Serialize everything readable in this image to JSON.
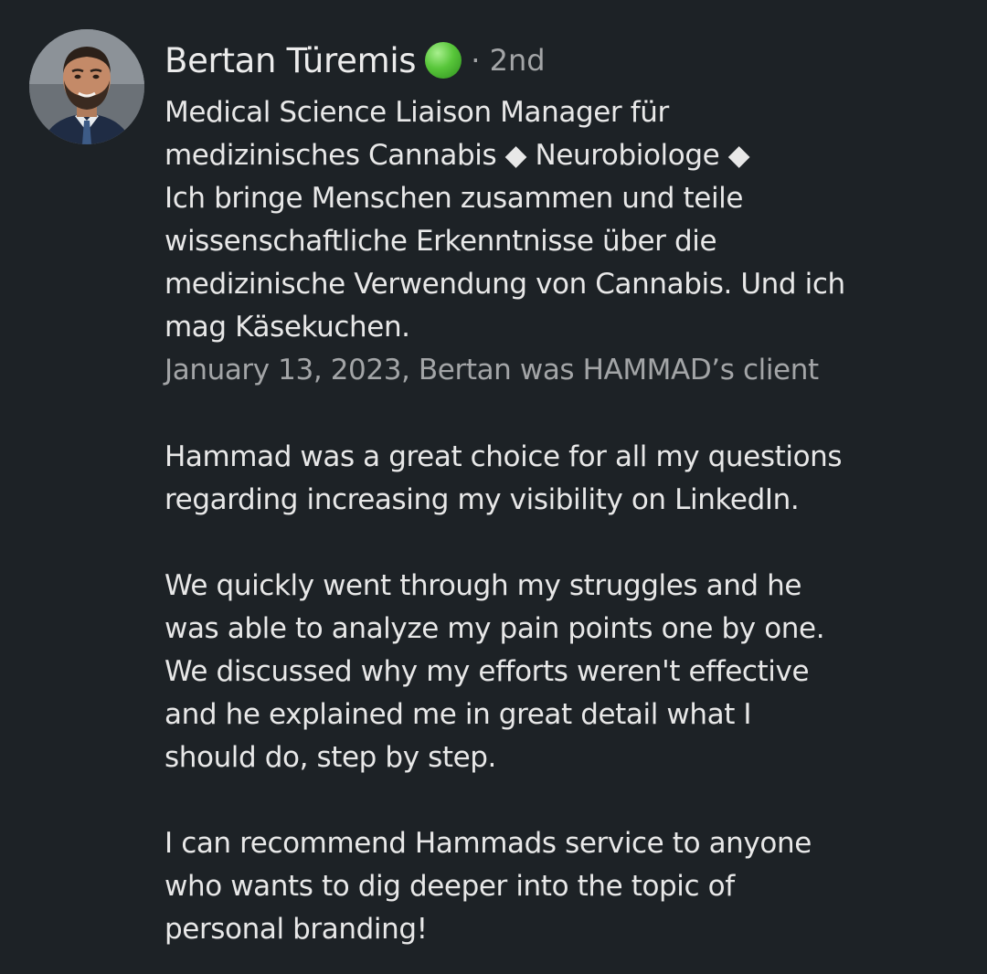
{
  "recommendation": {
    "author": {
      "name": "Bertan Türemis",
      "status_icon": "green-circle-icon",
      "connection_degree": "· 2nd",
      "headline": "Medical Science Liaison Manager für\nmedizinisches Cannabis ◆ Neurobiologe ◆\nIch bringe Menschen zusammen und teile\nwissenschaftliche Erkenntnisse über die\nmedizinische Verwendung von Cannabis. Und ich\nmag Käsekuchen."
    },
    "meta": "January 13, 2023, Bertan was HAMMAD’s client",
    "paragraphs": [
      "Hammad was a great choice for all my questions\nregarding increasing my visibility on LinkedIn.",
      "We quickly went through my struggles and he\nwas able to analyze my pain points one by one.\nWe discussed why my efforts weren't effective\nand he explained me in great detail what I\nshould do, step by step.",
      "I can recommend Hammads service to anyone\nwho wants to dig deeper into the topic of\npersonal branding!"
    ]
  },
  "colors": {
    "background": "#1d2226",
    "primary_text": "#e8e8e8",
    "secondary_text": "#a3a5a7",
    "status_green": "#58c63a"
  }
}
